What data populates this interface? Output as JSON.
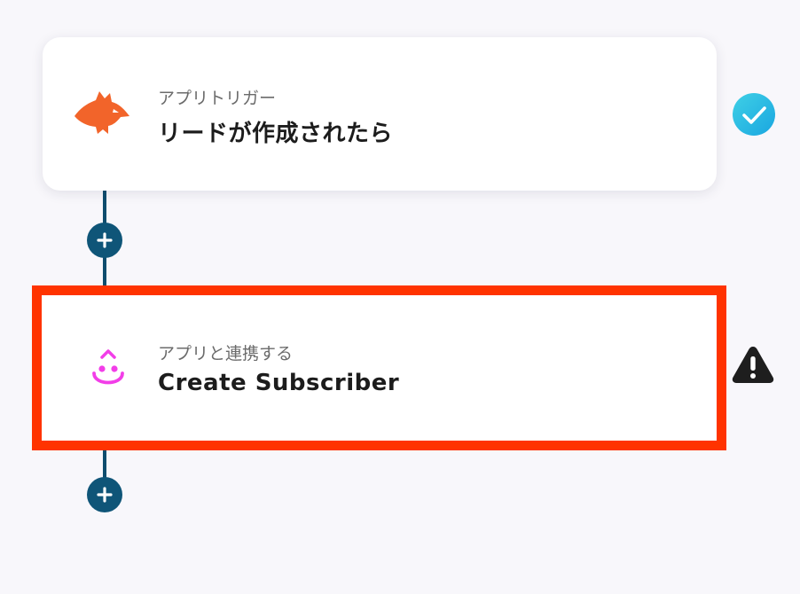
{
  "flow": {
    "steps": [
      {
        "kind_label": "アプリトリガー",
        "title": "リードが作成されたら",
        "app_icon": "fox-icon",
        "status_icon": "check-circle-icon",
        "status": "complete"
      },
      {
        "kind_label": "アプリと連携する",
        "title": "Create Subscriber",
        "app_icon": "smile-drop-icon",
        "status_icon": "warning-triangle-icon",
        "status": "warning"
      }
    ],
    "add_step_icon": "plus-icon"
  },
  "colors": {
    "background": "#f8f7fb",
    "connector": "#0f4d6e",
    "plus_button": "#0f5578",
    "highlight_border": "#ff3300",
    "check_gradient_start": "#3fd0e6",
    "check_gradient_end": "#1aa6e0",
    "warning": "#1e1e1e",
    "fox_orange": "#f2642a",
    "app_pink": "#f23ee8"
  }
}
